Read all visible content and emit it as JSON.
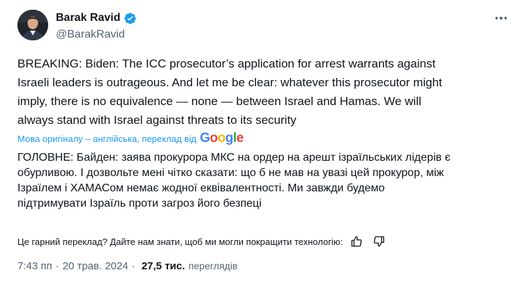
{
  "author": {
    "display_name": "Barak Ravid",
    "handle": "@BarakRavid",
    "verified": true,
    "verified_color": "#1d9bf0"
  },
  "tweet": {
    "lines": [
      "BREAKING: Biden: The ICC prosecutor’s application for arrest warrants against",
      "Israeli leaders is outrageous. And let me be clear: whatever this prosecutor might",
      "imply, there is no equivalence — none — between Israel and Hamas.  We will",
      "always stand with Israel against threats to its security"
    ]
  },
  "translation": {
    "note": "Мова оригіналу – англійська, переклад від",
    "provider": "Google",
    "lines": [
      "ГОЛОВНЕ: Байден: заява прокурора МКС на ордер на арешт ізраїльських лідерів є",
      "обурливою. І дозвольте мені чітко сказати: що б не мав на увазі цей прокурор, між",
      "Ізраїлем і ХАМАСом немає жодної еквівалентності. Ми завжди будемо",
      "підтримувати Ізраїль проти загроз його безпеці"
    ]
  },
  "feedback": {
    "question": "Це гарний переклад? Дайте нам знати, щоб ми могли покращити технологію:",
    "thumbs_up_icon": "thumbs-up-icon",
    "thumbs_down_icon": "thumbs-down-icon"
  },
  "meta": {
    "time": "7:43 пп",
    "date": "20 трав. 2024",
    "separator": "·",
    "views_count": "27,5 тис.",
    "views_label": "переглядів"
  },
  "colors": {
    "accent": "#1d9bf0",
    "text_primary": "#0f1419",
    "text_secondary": "#536471"
  }
}
